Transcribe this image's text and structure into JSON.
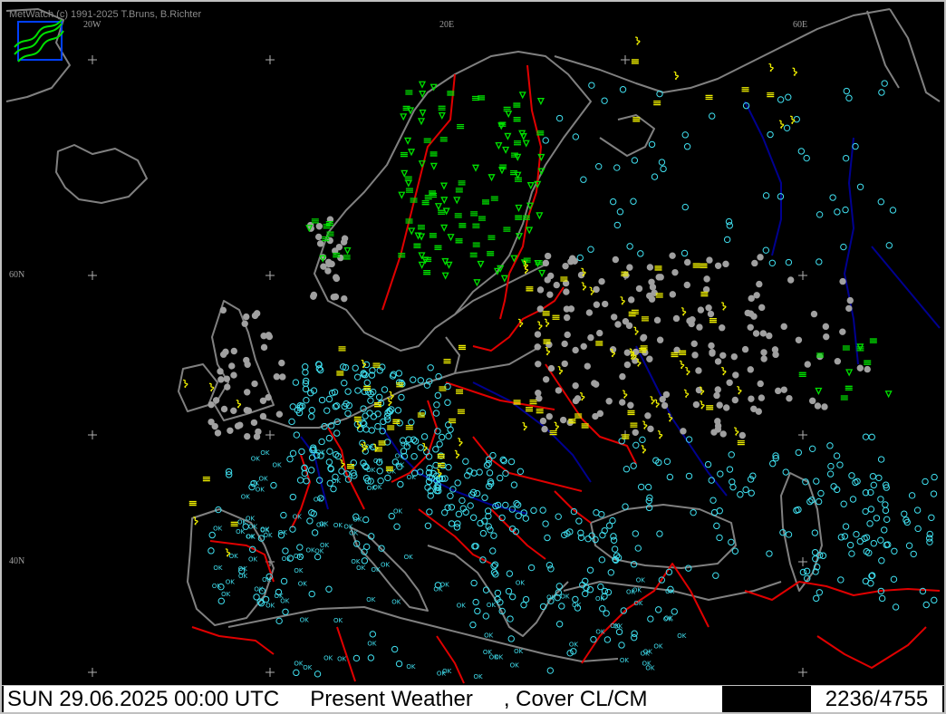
{
  "app": {
    "copyright": "MetWatch  (c) 1991-2025 T.Bruns, B.Richter"
  },
  "map": {
    "graticule_labels": {
      "lon_20w": "20W",
      "lon_20e": "20E",
      "lon_60e": "60E",
      "lat_60n": "60N",
      "lat_40n": "40N"
    },
    "colors": {
      "background": "#000000",
      "coastline": "#808080",
      "borders": "#e00000",
      "rivers": "#000090",
      "ok_station": "#40e0f0",
      "no_report_station": "#a0a0a0",
      "weather_green": "#00e000",
      "weather_yellow": "#f0f000"
    },
    "symbol_legend": {
      "ok": "OK"
    }
  },
  "status": {
    "datetime": "SUN 29.06.2025 00:00 UTC",
    "product": "Present Weather",
    "overlay": ", Cover CL/CM",
    "station_count": "2236/4755"
  }
}
